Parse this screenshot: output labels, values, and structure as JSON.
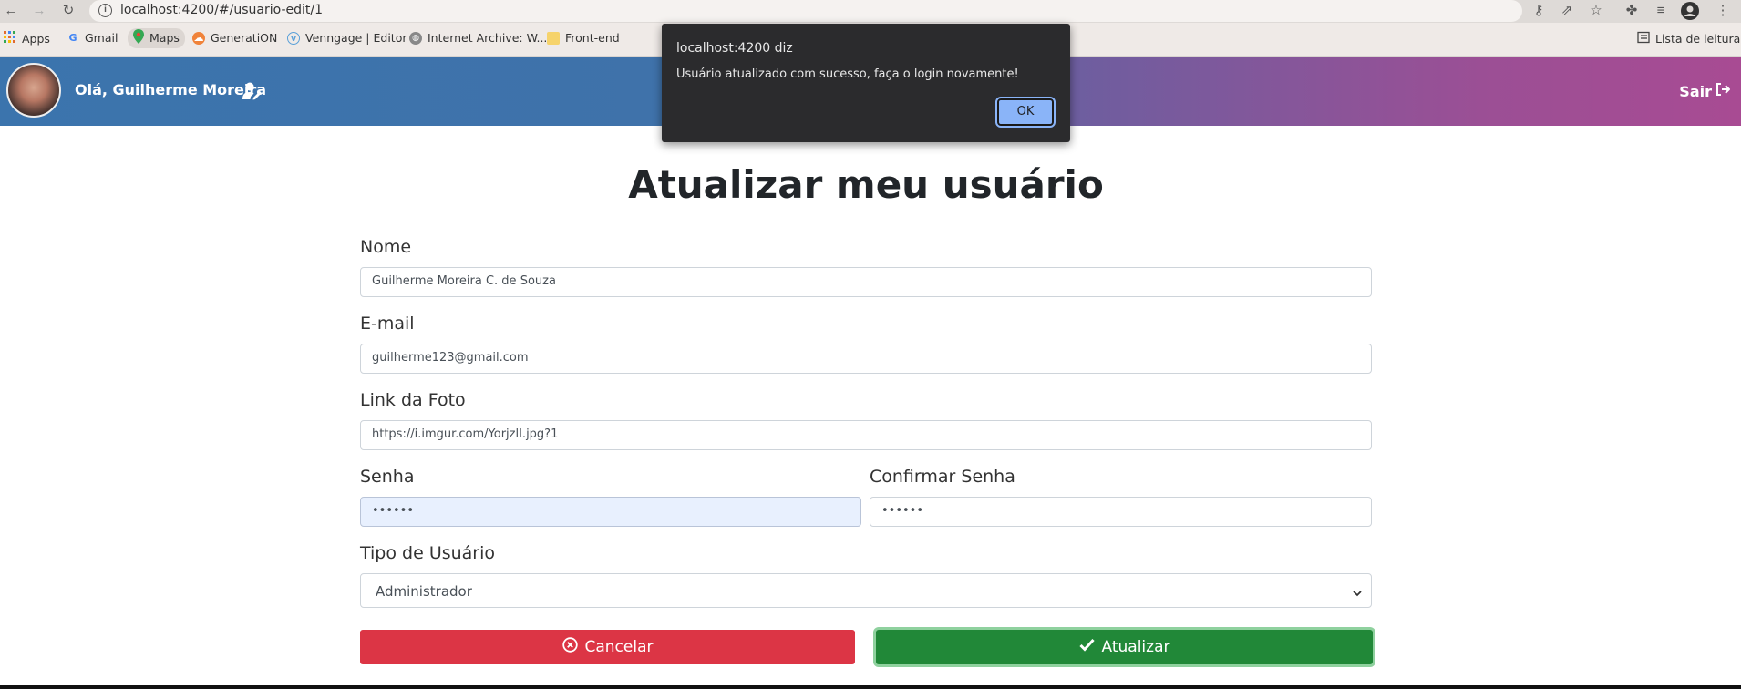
{
  "browser": {
    "url": "localhost:4200/#/usuario-edit/1",
    "bookmarks": [
      {
        "label": "Apps",
        "icon": "apps-grid-icon"
      },
      {
        "label": "Gmail",
        "icon": "google-icon"
      },
      {
        "label": "Maps",
        "icon": "maps-pin-icon"
      },
      {
        "label": "GeneratiON",
        "icon": "cloud-icon"
      },
      {
        "label": "Venngage | Editor",
        "icon": "venngage-icon"
      },
      {
        "label": "Internet Archive: W...",
        "icon": "globe-icon"
      },
      {
        "label": "Front-end",
        "icon": "folder-icon"
      }
    ],
    "reading_list": "Lista de leitura"
  },
  "header": {
    "greeting": "Olá, Guilherme Moreira",
    "logout_label": "Sair"
  },
  "form": {
    "title": "Atualizar meu usuário",
    "nome_label": "Nome",
    "nome_value": "Guilherme Moreira C. de Souza",
    "email_label": "E-mail",
    "email_value": "guilherme123@gmail.com",
    "foto_label": "Link da Foto",
    "foto_value": "https://i.imgur.com/YorjzlI.jpg?1",
    "senha_label": "Senha",
    "senha_value": "••••••",
    "confirmar_label": "Confirmar Senha",
    "confirmar_value": "••••••",
    "tipo_label": "Tipo de Usuário",
    "tipo_value": "Administrador",
    "cancel_label": "Cancelar",
    "update_label": "Atualizar"
  },
  "dialog": {
    "title": "localhost:4200 diz",
    "message": "Usuário atualizado com sucesso, faça o login novamente!",
    "ok_label": "OK"
  },
  "colors": {
    "danger": "#dc3545",
    "success": "#218838",
    "header_start": "#3b74ad",
    "header_end": "#a84b93"
  }
}
